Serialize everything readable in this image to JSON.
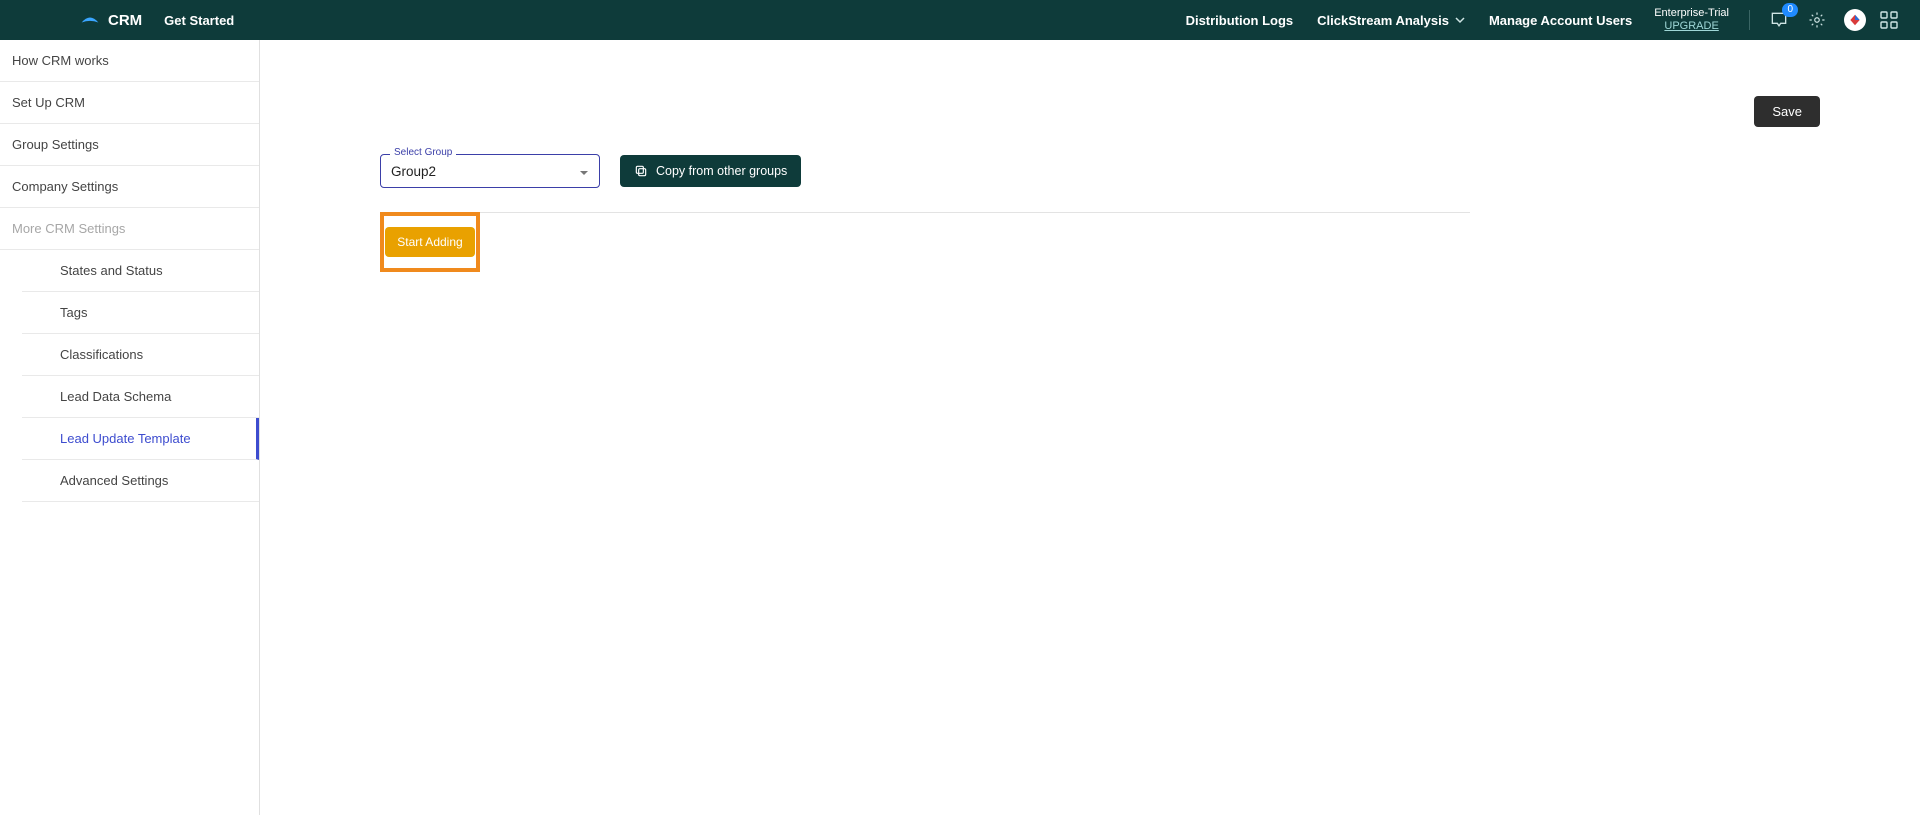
{
  "header": {
    "brand": "CRM",
    "get_started": "Get Started",
    "nav": {
      "dist_logs": "Distribution Logs",
      "clickstream": "ClickStream Analysis",
      "manage_users": "Manage Account Users"
    },
    "trial": {
      "plan": "Enterprise-Trial",
      "upgrade": "UPGRADE"
    },
    "mail_badge": "0"
  },
  "sidebar": {
    "items": [
      "How CRM works",
      "Set Up CRM",
      "Group Settings",
      "Company Settings"
    ],
    "section": "More CRM Settings",
    "subitems": [
      "States and Status",
      "Tags",
      "Classifications",
      "Lead Data Schema",
      "Lead Update Template",
      "Advanced Settings"
    ]
  },
  "main": {
    "save": "Save",
    "select_label": "Select Group",
    "select_value": "Group2",
    "copy_btn": "Copy from other groups",
    "start_adding": "Start Adding"
  }
}
